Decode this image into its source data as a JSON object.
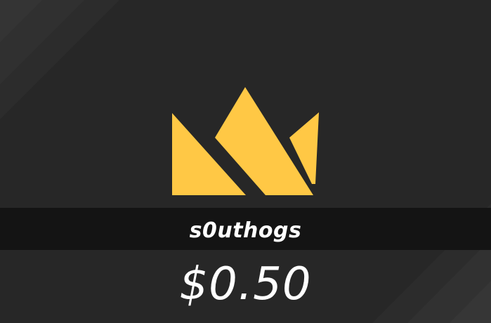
{
  "card": {
    "name": "s0uthogs",
    "price": "$0.50"
  },
  "logo": {
    "icon": "crown-icon",
    "color": "#ffc845"
  },
  "colors": {
    "background": "#272727",
    "stripe": "#2f2f2f",
    "band": "#141414",
    "text": "#ffffff"
  }
}
